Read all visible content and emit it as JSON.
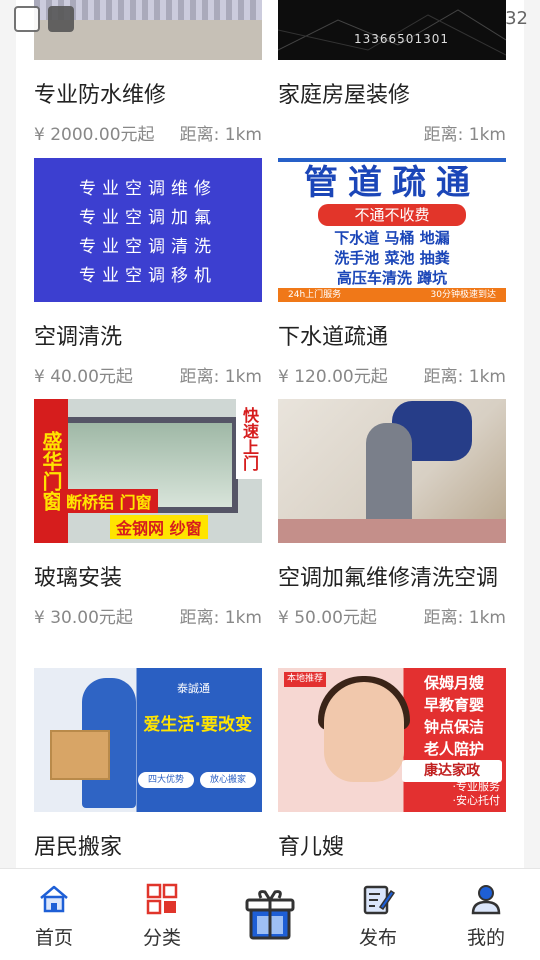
{
  "status_bar": {
    "time": "32",
    "icons": [
      "image-icon",
      "notification-icon"
    ]
  },
  "cards": [
    {
      "title": "专业防水维修",
      "price": "¥ 2000.00元起",
      "distance": "距离: 1km",
      "thumb": "roof"
    },
    {
      "title": "家庭房屋装修",
      "price": "",
      "distance": "距离: 1km",
      "thumb": "dark",
      "thumb_text": "13366501301"
    },
    {
      "title": "空调清洗",
      "price": "¥ 40.00元起",
      "distance": "距离: 1km",
      "thumb": "blue",
      "thumb_lines": [
        "专业空调维修",
        "专业空调加氟",
        "专业空调清洗",
        "专业空调移机"
      ]
    },
    {
      "title": "下水道疏通",
      "price": "¥ 120.00元起",
      "distance": "距离: 1km",
      "thumb": "pipe",
      "thumb_big": "管道疏通",
      "thumb_band": "不通不收费",
      "thumb_rows": [
        "下水道  马桶  地漏",
        "洗手池  菜池  抽粪",
        "高压车清洗  蹲坑"
      ],
      "thumb_foot_left": "24h上门服务",
      "thumb_foot_right": "30分钟极速到达"
    },
    {
      "title": "玻璃安装",
      "price": "¥ 30.00元起",
      "distance": "距离: 1km",
      "thumb": "window",
      "thumb_col": "盛华门窗",
      "thumb_col2": "快速上门",
      "thumb_b1": "断桥铝 门窗",
      "thumb_b2": "金钢网 纱窗"
    },
    {
      "title": "空调加氟维修清洗空调",
      "price": "¥ 50.00元起",
      "distance": "距离: 1km",
      "thumb": "photo"
    },
    {
      "title": "居民搬家",
      "price": "",
      "distance": "",
      "thumb": "move",
      "thumb_brand": "泰誠通",
      "thumb_text": "爱生活·要改变",
      "thumb_pill1": "四大优势",
      "thumb_pill2": "放心搬家"
    },
    {
      "title": "育儿嫂",
      "price": "",
      "distance": "",
      "thumb": "nanny",
      "thumb_tag": "本地推荐",
      "thumb_lines": [
        "保姆月嫂",
        "早教育婴",
        "钟点保洁",
        "老人陪护"
      ],
      "thumb_logo": "康达家政",
      "thumb_svc1": "·专业服务",
      "thumb_svc2": "·安心托付"
    }
  ],
  "tabbar": {
    "home": "首页",
    "category": "分类",
    "publish": "发布",
    "mine": "我的"
  },
  "colors": {
    "accent": "#1e5fd6",
    "category_red": "#e0352b"
  }
}
